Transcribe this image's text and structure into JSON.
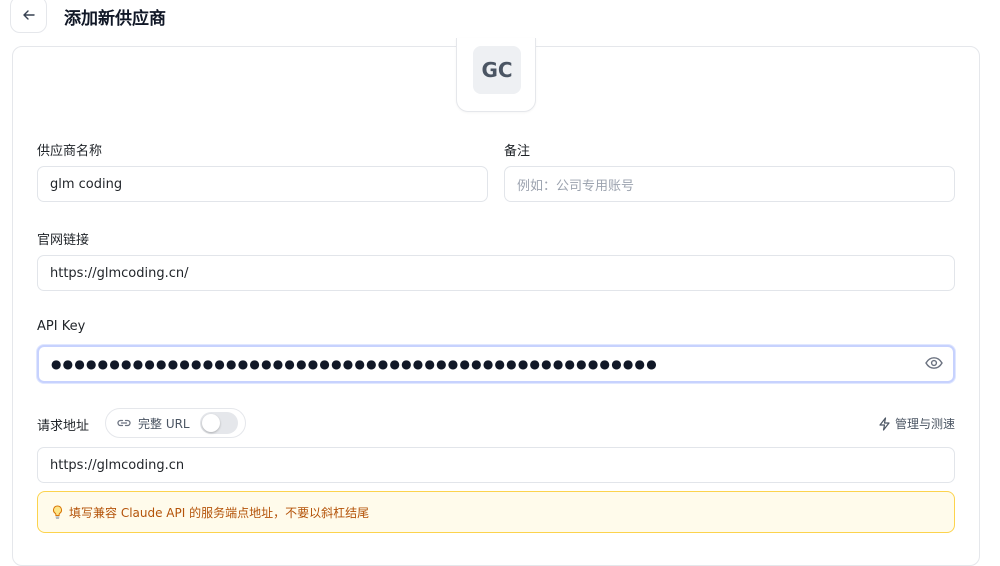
{
  "header": {
    "title": "添加新供应商"
  },
  "avatar": {
    "initials": "GC"
  },
  "form": {
    "name": {
      "label": "供应商名称",
      "value": "glm coding"
    },
    "note": {
      "label": "备注",
      "placeholder": "例如：公司专用账号"
    },
    "website": {
      "label": "官网链接",
      "value": "https://glmcoding.cn/"
    },
    "api_key": {
      "label": "API Key",
      "masked_value": "●●●●●●●●●●●●●●●●●●●●●●●●●●●●●●●●●●●●●●●●●●●●●●●●●●●●"
    },
    "endpoint": {
      "label": "请求地址",
      "full_url_toggle_label": "完整 URL",
      "full_url_enabled": false,
      "manage_label": "管理与测速",
      "value": "https://glmcoding.cn",
      "hint": "填写兼容 Claude API 的服务端点地址，不要以斜杠结尾"
    }
  },
  "colors": {
    "hint_bg": "#fffbeb",
    "hint_border": "#fcd34d",
    "hint_text": "#b45309"
  }
}
